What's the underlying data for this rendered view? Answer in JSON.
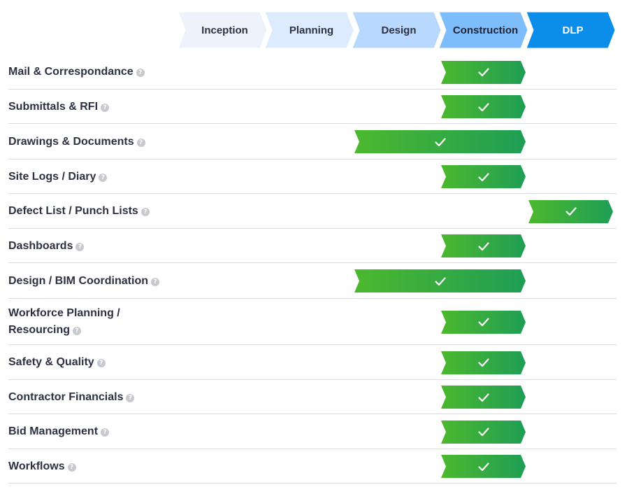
{
  "stages": [
    {
      "label": "Inception",
      "color": "#eef2fb",
      "text_color": "#2d3142"
    },
    {
      "label": "Planning",
      "color": "#dcebfd",
      "text_color": "#2d3142"
    },
    {
      "label": "Design",
      "color": "#b8d9fd",
      "text_color": "#2d3142"
    },
    {
      "label": "Construction",
      "color": "#7dbdfb",
      "text_color": "#1f2233"
    },
    {
      "label": "DLP",
      "color": "#0b8eea",
      "text_color": "#ffffff"
    }
  ],
  "features": [
    {
      "label": "Mail & Correspondance",
      "stages": [
        3
      ]
    },
    {
      "label": "Submittals & RFI",
      "stages": [
        3
      ]
    },
    {
      "label": "Drawings & Documents",
      "stages": [
        2,
        3
      ]
    },
    {
      "label": "Site Logs / Diary",
      "stages": [
        3
      ]
    },
    {
      "label": "Defect List / Punch Lists",
      "stages": [
        4
      ]
    },
    {
      "label": "Dashboards",
      "stages": [
        3
      ]
    },
    {
      "label": "Design / BIM Coordination",
      "stages": [
        2,
        3
      ]
    },
    {
      "label": "Workforce Planning / Resourcing",
      "stages": [
        3
      ]
    },
    {
      "label": "Safety & Quality",
      "stages": [
        3
      ]
    },
    {
      "label": "Contractor Financials",
      "stages": [
        3
      ]
    },
    {
      "label": "Bid Management",
      "stages": [
        3
      ]
    },
    {
      "label": "Workflows",
      "stages": [
        3
      ]
    }
  ],
  "icons": {
    "check": "check-icon",
    "help": "help-icon",
    "help_glyph": "?"
  },
  "colors": {
    "bar_start": "#4cb82e",
    "bar_end": "#1f9e55",
    "divider": "#d9dbe0",
    "label": "#2d3142"
  }
}
